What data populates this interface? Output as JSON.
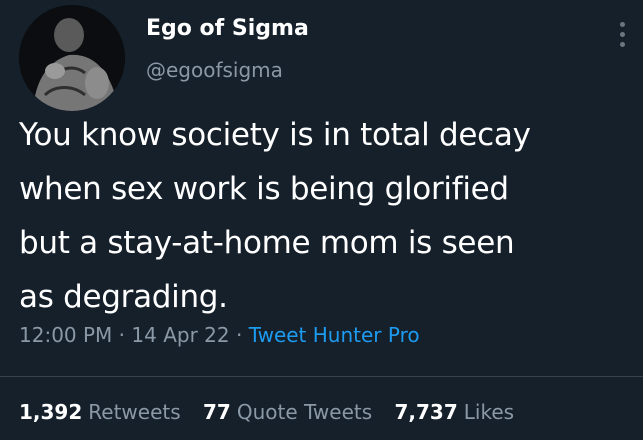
{
  "tweet": {
    "author": {
      "display_name": "Ego of Sigma",
      "handle": "@egoofsigma",
      "avatar_icon": "statue-avatar"
    },
    "more_icon": "more-vertical-icon",
    "text_lines": [
      "You know society is in total decay",
      "when sex work is being glorified",
      "but a stay-at-home mom is seen",
      "as degrading."
    ],
    "time": "12:00 PM",
    "date": "14 Apr 22",
    "separator": "·",
    "source": "Tweet Hunter Pro",
    "stats": {
      "retweets_count": "1,392",
      "retweets_label": "Retweets",
      "quotes_count": "77",
      "quotes_label": "Quote Tweets",
      "likes_count": "7,737",
      "likes_label": "Likes"
    },
    "colors": {
      "background": "#15202b",
      "secondary_text": "#8b98a5",
      "link": "#1d9bf0"
    }
  }
}
